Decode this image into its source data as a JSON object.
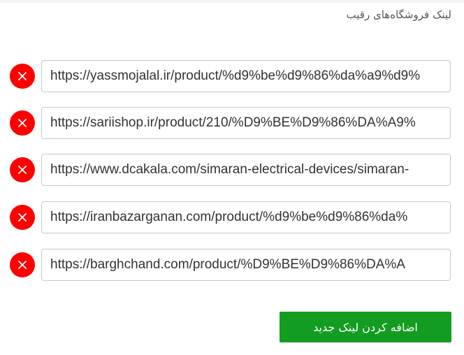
{
  "section": {
    "title": "لینک فروشگاه‌های رقیب"
  },
  "links": [
    {
      "url": "https://yassmojalal.ir/product/%d9%be%d9%86%da%a9%d9%"
    },
    {
      "url": "https://sariishop.ir/product/210/%D9%BE%D9%86%DA%A9%"
    },
    {
      "url": "https://www.dcakala.com/simaran-electrical-devices/simaran-"
    },
    {
      "url": "https://iranbazarganan.com/product/%d9%be%d9%86%da%"
    },
    {
      "url": "https://barghchand.com/product/%D9%BE%D9%86%DA%A"
    }
  ],
  "add_button": {
    "label": "اضافه کردن لینک جدید"
  },
  "colors": {
    "remove": "#ff0000",
    "add": "#129c20",
    "border": "#c8c8c8",
    "text": "#333333"
  },
  "icons": {
    "remove": "close-icon"
  }
}
